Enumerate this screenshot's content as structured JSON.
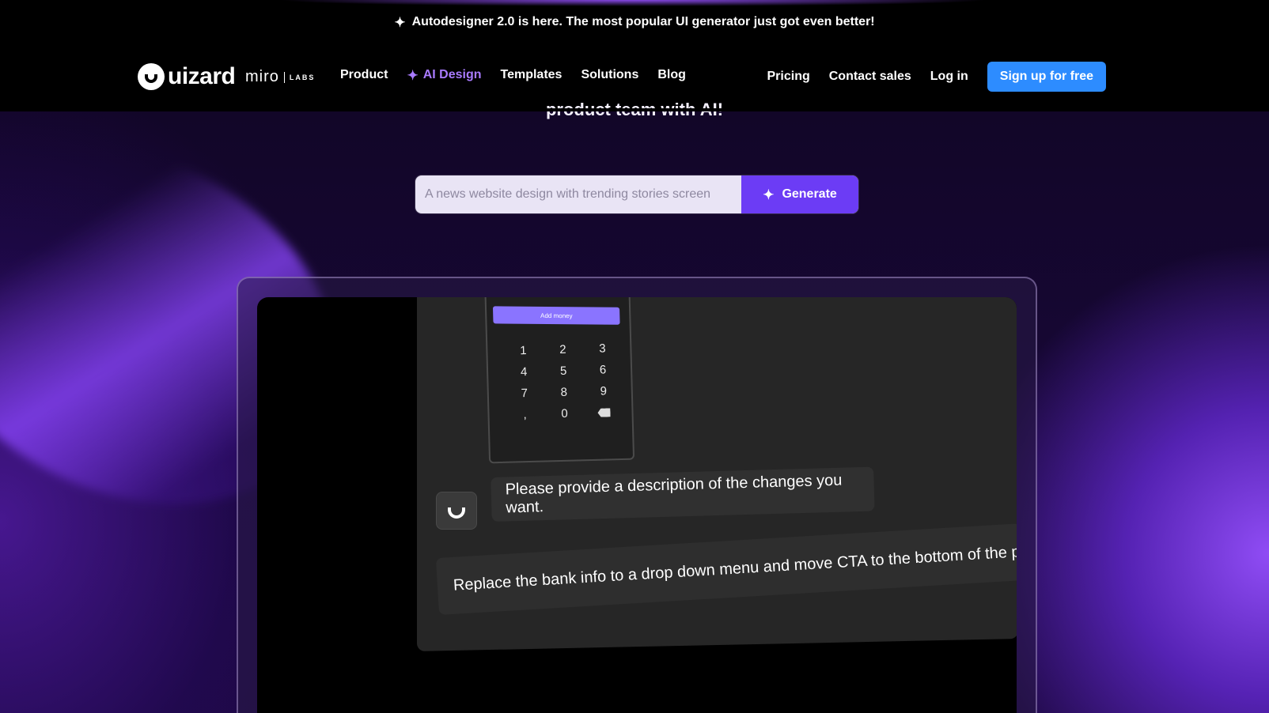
{
  "announcement": {
    "icon": "sparkle-icon",
    "text": "Autodesigner 2.0 is here. The most popular UI generator just got even better!"
  },
  "nav": {
    "logo_text": "uizard",
    "partner_logo": "miro",
    "partner_tag": "LABS",
    "links": [
      {
        "label": "Product"
      },
      {
        "label": "AI Design",
        "icon": "sparkle-icon",
        "active": true
      },
      {
        "label": "Templates"
      },
      {
        "label": "Solutions"
      },
      {
        "label": "Blog"
      }
    ],
    "right_links": [
      {
        "label": "Pricing"
      },
      {
        "label": "Contact sales"
      },
      {
        "label": "Log in"
      }
    ],
    "cta": "Sign up for free"
  },
  "hero": {
    "subtitle_fragment": "product team with AI!"
  },
  "generator": {
    "placeholder": "A news website design with trending stories screen",
    "button_label": "Generate",
    "button_icon": "sparkle-icon"
  },
  "demo": {
    "phone_button": "Add money",
    "keypad": [
      "1",
      "2",
      "3",
      "4",
      "5",
      "6",
      "7",
      "8",
      "9",
      ",",
      "0",
      "⌫"
    ],
    "bot_message": "Please provide a description of the changes you want.",
    "user_message": "Replace the bank info to a drop down menu and move CTA to the bottom of the page"
  },
  "colors": {
    "accent": "#6c3cf5",
    "active_link": "#a97bff",
    "cta": "#2d8cff"
  }
}
